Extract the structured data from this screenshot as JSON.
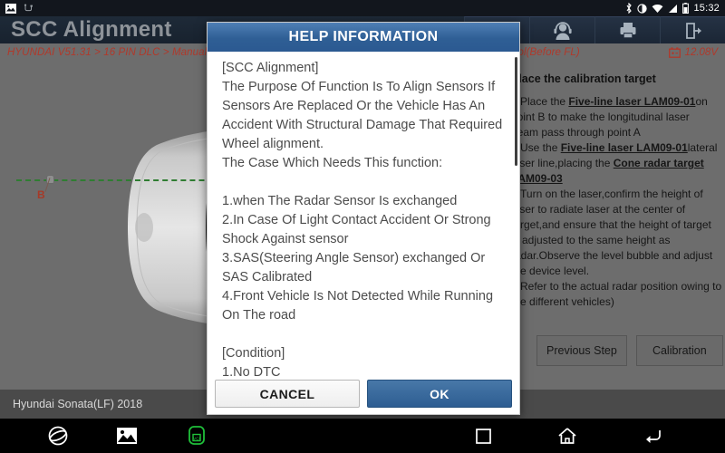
{
  "status_bar": {
    "icons_left": [
      "screenshot-icon",
      "usb-icon"
    ],
    "icons_right": [
      "bluetooth-icon",
      "dnd-icon",
      "wifi-icon",
      "signal-icon",
      "battery-icon"
    ],
    "time": "15:32"
  },
  "header": {
    "title": "SCC Alignment",
    "toolbar": [
      {
        "name": "help-button",
        "icon": "question-icon"
      },
      {
        "name": "support-button",
        "icon": "headset-icon"
      },
      {
        "name": "print-button",
        "icon": "printer-icon"
      },
      {
        "name": "exit-button",
        "icon": "exit-icon"
      }
    ]
  },
  "breadcrumb": {
    "path": "HYUNDAI V51.31 > 16 PIN DLC > Manual Selection > Sonata(LF) > 2018 > G 2.0 ATK > Smart Cruise Control(Before FL)",
    "battery_icon": "battery-voltage-icon",
    "voltage": "12.08V"
  },
  "main": {
    "diagram": {
      "point_label": "B",
      "laser_color": "#2f7d32",
      "label_color": "#a63a28",
      "vehicle": "top-view-sedan-illustration"
    },
    "instructions": {
      "heading": "Place the calibration target",
      "lines": [
        {
          "segments": [
            {
              "t": "1.Place the ",
              "b": false
            },
            {
              "t": "Five-line laser LAM09-01",
              "b": true
            },
            {
              "t": "on",
              "b": false
            }
          ]
        },
        {
          "segments": [
            {
              "t": "point B to make the longitudinal laser",
              "b": false
            }
          ]
        },
        {
          "segments": [
            {
              "t": "beam pass through point A",
              "b": false
            }
          ]
        },
        {
          "segments": [
            {
              "t": "2.Use the ",
              "b": false
            },
            {
              "t": "Five-line laser LAM09-01",
              "b": true
            },
            {
              "t": "lateral",
              "b": false
            }
          ]
        },
        {
          "segments": [
            {
              "t": "laser line,placing the ",
              "b": false
            },
            {
              "t": "Cone radar target",
              "b": true
            }
          ]
        },
        {
          "segments": [
            {
              "t": "LAM09-03",
              "b": true
            }
          ]
        },
        {
          "segments": [
            {
              "t": "3.Turn on the laser,confirm the height of",
              "b": false
            }
          ]
        },
        {
          "segments": [
            {
              "t": "laser to radiate laser at the center of",
              "b": false
            }
          ]
        },
        {
          "segments": [
            {
              "t": "target,and ensure that the height of target",
              "b": false
            }
          ]
        },
        {
          "segments": [
            {
              "t": "is adjusted to the same height as",
              "b": false
            }
          ]
        },
        {
          "segments": [
            {
              "t": "radar.Observe the level bubble and adjust",
              "b": false
            }
          ]
        },
        {
          "segments": [
            {
              "t": "the device level.",
              "b": false
            }
          ]
        },
        {
          "segments": [
            {
              "t": "4.Refer to the actual radar position owing to",
              "b": false
            }
          ]
        },
        {
          "segments": [
            {
              "t": "the different vehicles)",
              "b": false
            }
          ]
        }
      ],
      "buttons": [
        {
          "name": "previous-step-button",
          "label": "Previous Step"
        },
        {
          "name": "calibration-button",
          "label": "Calibration"
        }
      ]
    }
  },
  "vehicle_bar": {
    "vehicle": "Hyundai Sonata(LF) 2018"
  },
  "nav_bar": {
    "left_icons": [
      "browser-icon",
      "gallery-icon",
      "vci-icon"
    ],
    "right_icons": [
      "recents-icon",
      "home-icon",
      "back-icon"
    ],
    "vci_color": "#1fbf3a"
  },
  "dialog": {
    "title": "HELP INFORMATION",
    "paragraphs": [
      "[SCC Alignment]",
      "The Purpose Of Function Is To Align Sensors If Sensors Are Replaced Or the Vehicle Has An Accident With Structural Damage That Required Wheel alignment.",
      "The Case Which Needs This function:",
      "",
      "1.when The Radar Sensor Is exchanged",
      "2.In Case Of Light Contact Accident Or Strong Shock Against sensor",
      "3.SAS(Steering Angle Sensor) exchanged Or SAS Calibrated",
      "4.Front Vehicle Is Not Detected While Running On The road",
      "",
      "[Condition]",
      "1.No DTC"
    ],
    "cancel_label": "CANCEL",
    "ok_label": "OK",
    "accent_color": "#2d5d92"
  }
}
